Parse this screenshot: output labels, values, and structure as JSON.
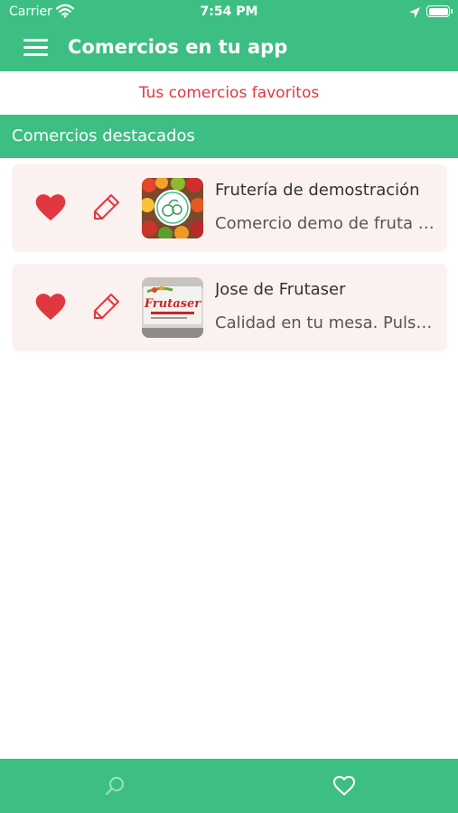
{
  "status_bar": {
    "carrier": "Carrier",
    "time": "7:54 PM",
    "wifi_icon": "wifi-icon",
    "location_icon": "location-arrow-icon",
    "battery_icon": "battery-icon"
  },
  "header": {
    "title": "Comercios en tu app",
    "menu_icon": "hamburger-menu-icon"
  },
  "favorites_link": "Tus comercios favoritos",
  "section": {
    "title": "Comercios destacados"
  },
  "businesses": [
    {
      "title": "Frutería de demostración",
      "description": "Comercio demo de fruta y verdura",
      "thumbnail_icon": "fruit-shop-logo-image",
      "favorite_icon": "heart-icon",
      "edit_icon": "pencil-icon"
    },
    {
      "title": "Jose de Frutaser",
      "description": "Calidad en tu mesa. Pulsa para ver más",
      "thumbnail_icon": "frutaser-truck-image",
      "thumbnail_text": "Frutaser",
      "favorite_icon": "heart-icon",
      "edit_icon": "pencil-icon"
    }
  ],
  "tab_bar": {
    "search_icon": "search-icon",
    "favorites_icon": "heart-outline-icon"
  },
  "colors": {
    "primary_green": "#3dbf84",
    "accent_red": "#e0383e",
    "card_background": "#fcf1f1"
  }
}
